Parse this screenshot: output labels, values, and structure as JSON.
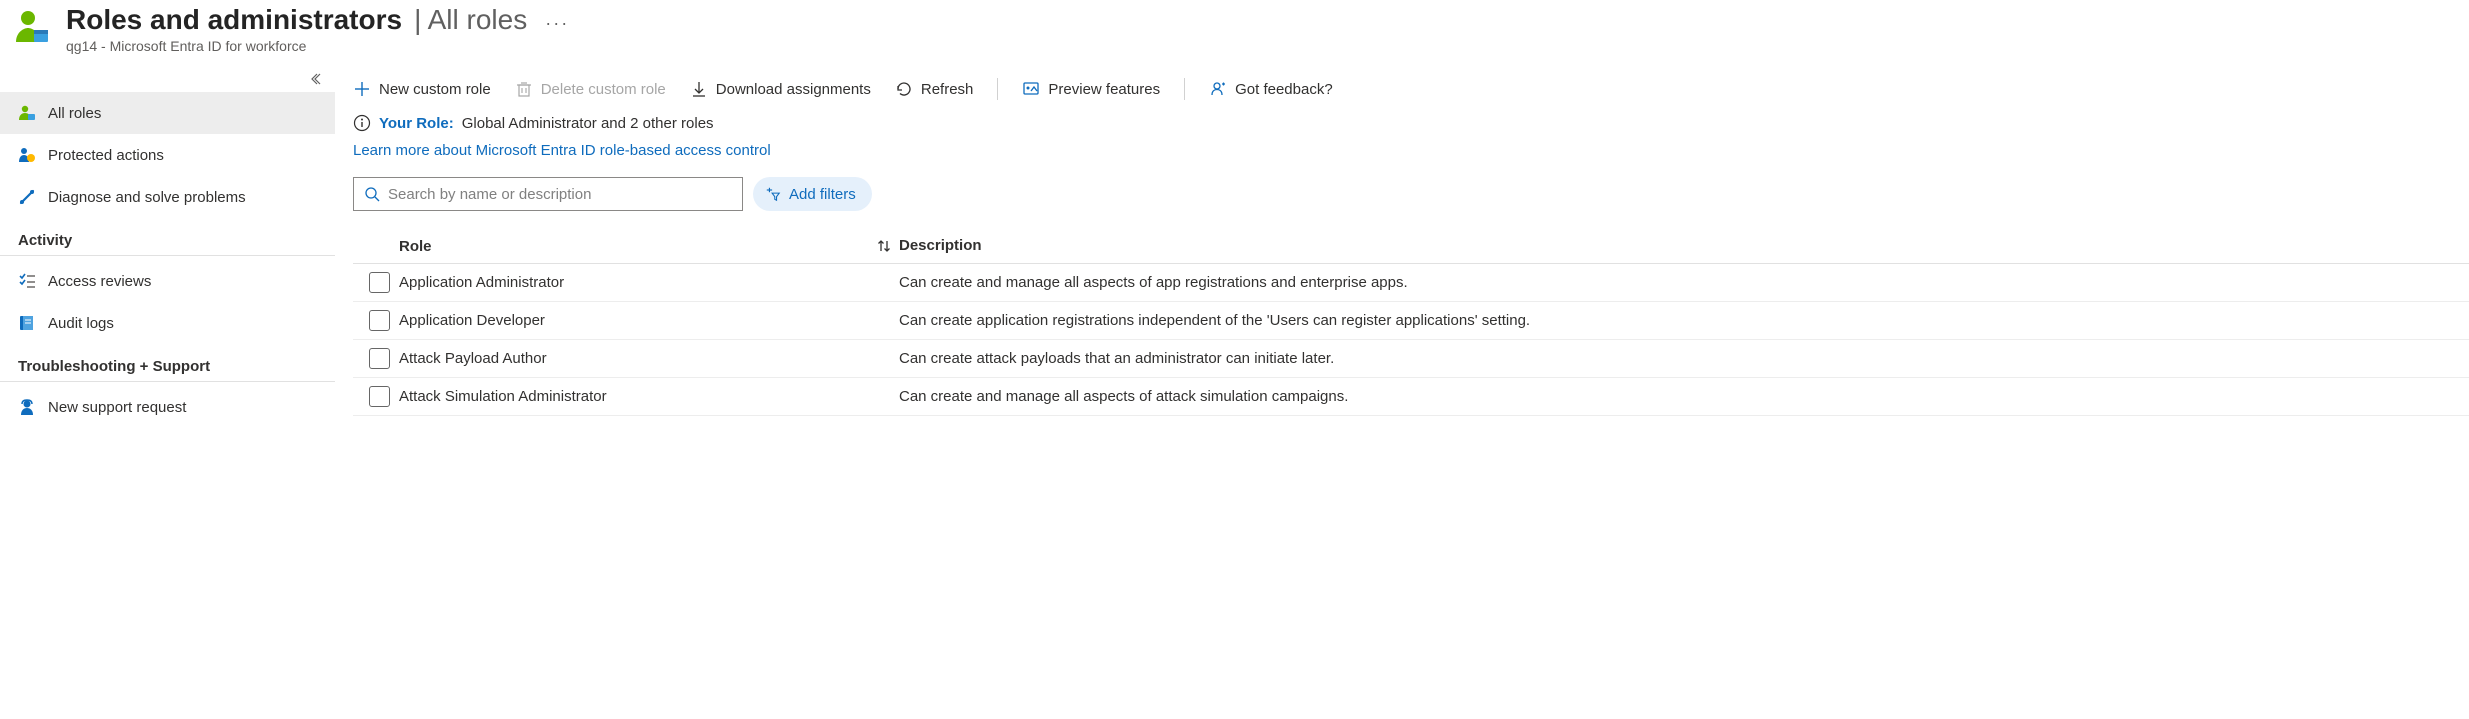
{
  "header": {
    "title": "Roles and administrators",
    "subtitle": "All roles",
    "breadcrumb": "qg14 - Microsoft Entra ID for workforce"
  },
  "sidebar": {
    "items": [
      {
        "label": "All roles"
      },
      {
        "label": "Protected actions"
      },
      {
        "label": "Diagnose and solve problems"
      }
    ],
    "section_activity": "Activity",
    "activity_items": [
      {
        "label": "Access reviews"
      },
      {
        "label": "Audit logs"
      }
    ],
    "section_troubleshooting": "Troubleshooting + Support",
    "support_items": [
      {
        "label": "New support request"
      }
    ]
  },
  "toolbar": {
    "new_custom_role": "New custom role",
    "delete_custom_role": "Delete custom role",
    "download_assignments": "Download assignments",
    "refresh": "Refresh",
    "preview_features": "Preview features",
    "got_feedback": "Got feedback?"
  },
  "info": {
    "label": "Your Role:",
    "value": "Global Administrator and 2 other roles",
    "learn_more": "Learn more about Microsoft Entra ID role-based access control"
  },
  "search": {
    "placeholder": "Search by name or description",
    "add_filters": "Add filters"
  },
  "table": {
    "col_role": "Role",
    "col_desc": "Description",
    "rows": [
      {
        "role": "Application Administrator",
        "desc": "Can create and manage all aspects of app registrations and enterprise apps."
      },
      {
        "role": "Application Developer",
        "desc": "Can create application registrations independent of the 'Users can register applications' setting."
      },
      {
        "role": "Attack Payload Author",
        "desc": "Can create attack payloads that an administrator can initiate later."
      },
      {
        "role": "Attack Simulation Administrator",
        "desc": "Can create and manage all aspects of attack simulation campaigns."
      }
    ]
  }
}
